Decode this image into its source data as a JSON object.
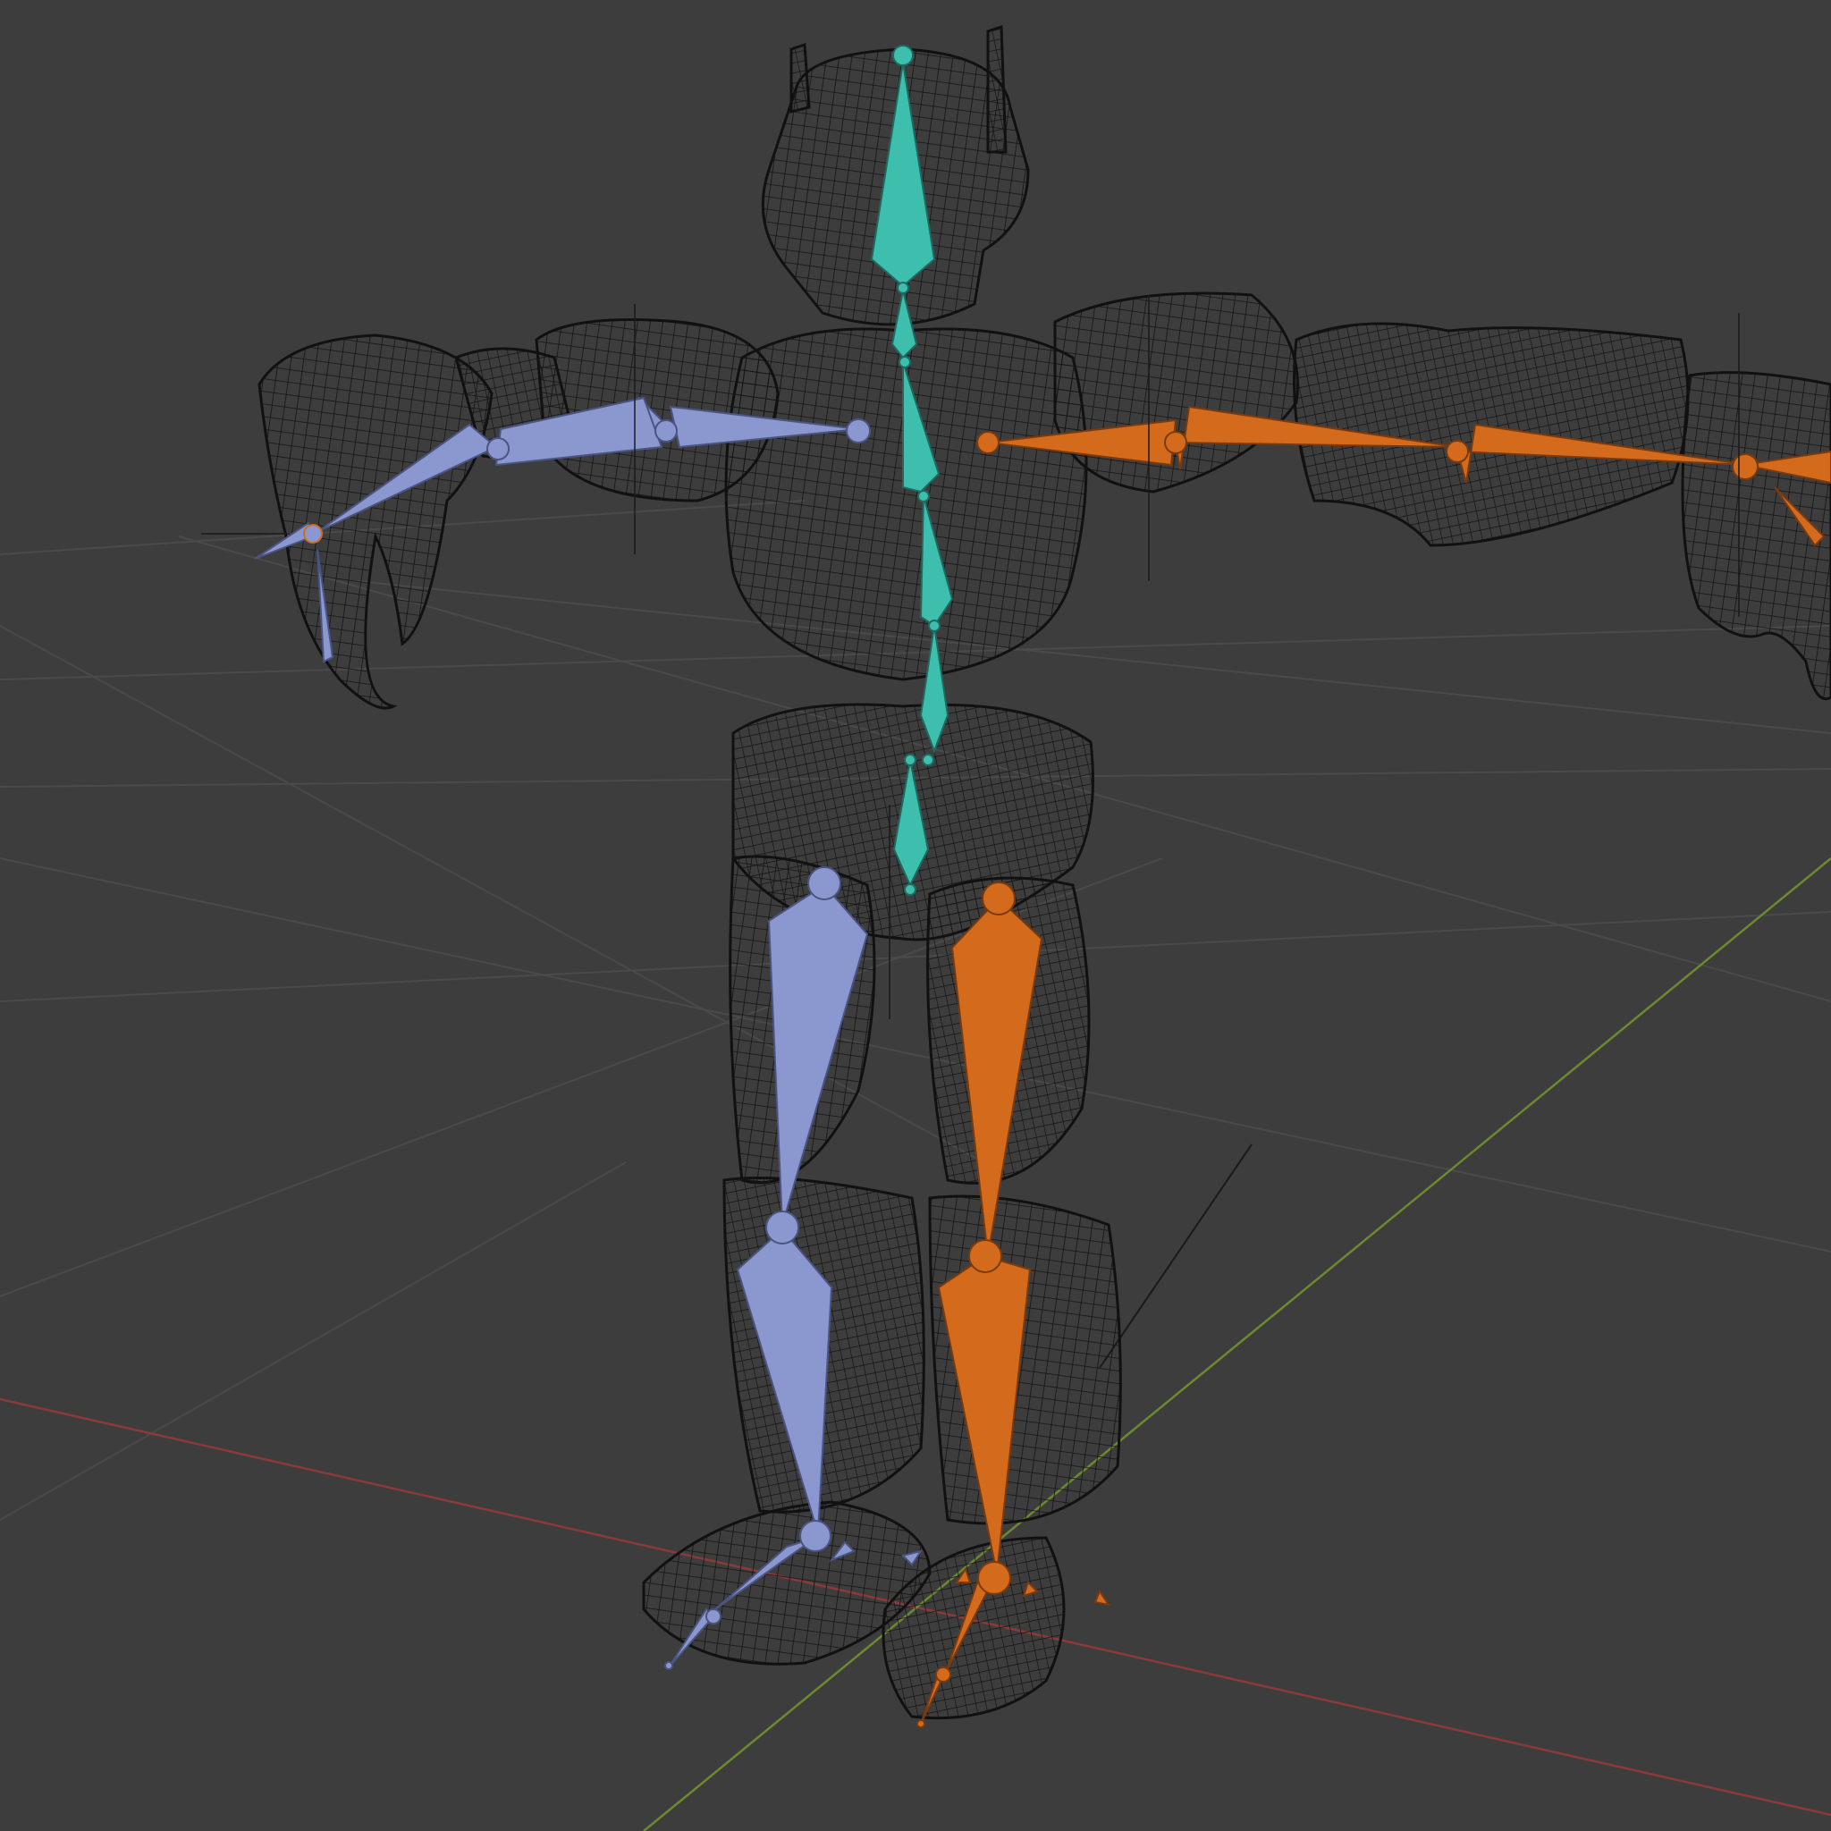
{
  "viewport": {
    "view": "3d-viewport",
    "shading": "wireframe",
    "object": "armature-over-character-mesh"
  },
  "colors": {
    "background": "#3d3d3d",
    "grid": "#4a4a4a",
    "x_axis": "#8a3a3a",
    "y_axis": "#6b8a2e",
    "wire": "#151515",
    "spine_bones": "#3ebfae",
    "left_bones": "#8a98cf",
    "right_bones": "#d36a1c"
  },
  "bones": {
    "spine_count": 8,
    "left_arm_count": 3,
    "right_arm_count": 3,
    "left_leg_count": 2,
    "right_leg_count": 2
  }
}
